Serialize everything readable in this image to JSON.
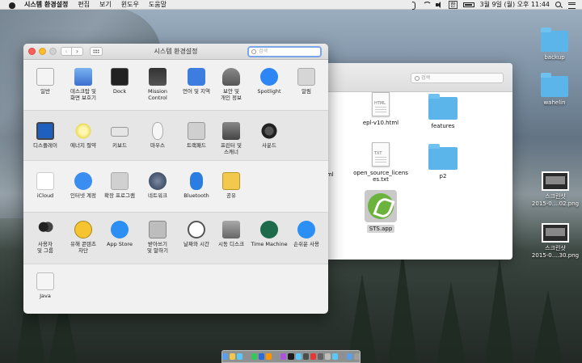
{
  "menubar": {
    "app_name": "시스템 환경설정",
    "menus": [
      "편집",
      "보기",
      "윈도우",
      "도움말"
    ],
    "input_flag": "한",
    "datetime": "3월 9일 (월) 오후 11:44"
  },
  "syspref": {
    "title": "시스템 환경설정",
    "search_placeholder": "검색",
    "sections": [
      [
        {
          "label": "일반",
          "icon": "general-icon"
        },
        {
          "label": "데스크탑 및\n화면 보호기",
          "icon": "desktop-screensaver-icon"
        },
        {
          "label": "Dock",
          "icon": "dock-icon"
        },
        {
          "label": "Mission\nControl",
          "icon": "mission-control-icon"
        },
        {
          "label": "언어 및 지역",
          "icon": "language-region-icon"
        },
        {
          "label": "보안 및\n개인 정보",
          "icon": "security-privacy-icon"
        },
        {
          "label": "Spotlight",
          "icon": "spotlight-icon"
        },
        {
          "label": "알림",
          "icon": "notifications-icon"
        }
      ],
      [
        {
          "label": "디스플레이",
          "icon": "displays-icon"
        },
        {
          "label": "에너지 절약",
          "icon": "energy-saver-icon"
        },
        {
          "label": "키보드",
          "icon": "keyboard-icon"
        },
        {
          "label": "마우스",
          "icon": "mouse-icon"
        },
        {
          "label": "트랙패드",
          "icon": "trackpad-icon"
        },
        {
          "label": "프린터 및\n스캐너",
          "icon": "printers-scanners-icon"
        },
        {
          "label": "사운드",
          "icon": "sound-icon"
        }
      ],
      [
        {
          "label": "iCloud",
          "icon": "icloud-icon"
        },
        {
          "label": "인터넷 계정",
          "icon": "internet-accounts-icon"
        },
        {
          "label": "확장 프로그램",
          "icon": "extensions-icon"
        },
        {
          "label": "네트워크",
          "icon": "network-icon"
        },
        {
          "label": "Bluetooth",
          "icon": "bluetooth-icon"
        },
        {
          "label": "공유",
          "icon": "sharing-icon"
        }
      ],
      [
        {
          "label": "사용자\n및 그룹",
          "icon": "users-groups-icon"
        },
        {
          "label": "유해 콘텐츠\n차단",
          "icon": "parental-controls-icon"
        },
        {
          "label": "App Store",
          "icon": "app-store-icon"
        },
        {
          "label": "받아쓰기\n및 말하기",
          "icon": "dictation-speech-icon"
        },
        {
          "label": "날짜와 시간",
          "icon": "date-time-icon"
        },
        {
          "label": "시동 디스크",
          "icon": "startup-disk-icon"
        },
        {
          "label": "Time Machine",
          "icon": "time-machine-icon"
        },
        {
          "label": "손쉬운 사용",
          "icon": "accessibility-icon"
        }
      ],
      [
        {
          "label": "Java",
          "icon": "java-icon"
        }
      ]
    ]
  },
  "finder": {
    "search_placeholder": "검색",
    "items": [
      {
        "label": "s",
        "kind": "partial"
      },
      {
        "label": "epl-v10.html",
        "kind": "doc",
        "badge": "HTML"
      },
      {
        "label": "features",
        "kind": "folder"
      },
      {
        "label": "tml",
        "kind": "partial"
      },
      {
        "label": "open_source_licens\nes.txt",
        "kind": "doc",
        "badge": "TXT"
      },
      {
        "label": "p2",
        "kind": "folder"
      },
      {
        "label": "STS.app",
        "kind": "app"
      }
    ]
  },
  "desktop": {
    "icons": [
      {
        "label": "backup",
        "kind": "folder"
      },
      {
        "label": "wahelin",
        "kind": "folder"
      },
      {
        "label": "스크린샷\n2015-0....02.png",
        "kind": "screenshot"
      },
      {
        "label": "스크린샷\n2015-0....30.png",
        "kind": "screenshot"
      }
    ]
  },
  "dock": {
    "colors": [
      "#5aa0e8",
      "#f2c94c",
      "#5ac8fa",
      "#8e8e93",
      "#34c759",
      "#2d6ad7",
      "#ff9500",
      "#8e8e93",
      "#af52de",
      "#1c1c1e",
      "#5ac8fa",
      "#4d4d4d",
      "#e53935",
      "#636366",
      "#bdbdbd",
      "#5ac8fa",
      "#8e8e93",
      "#5aa0e8",
      "#9e9e9e"
    ]
  }
}
